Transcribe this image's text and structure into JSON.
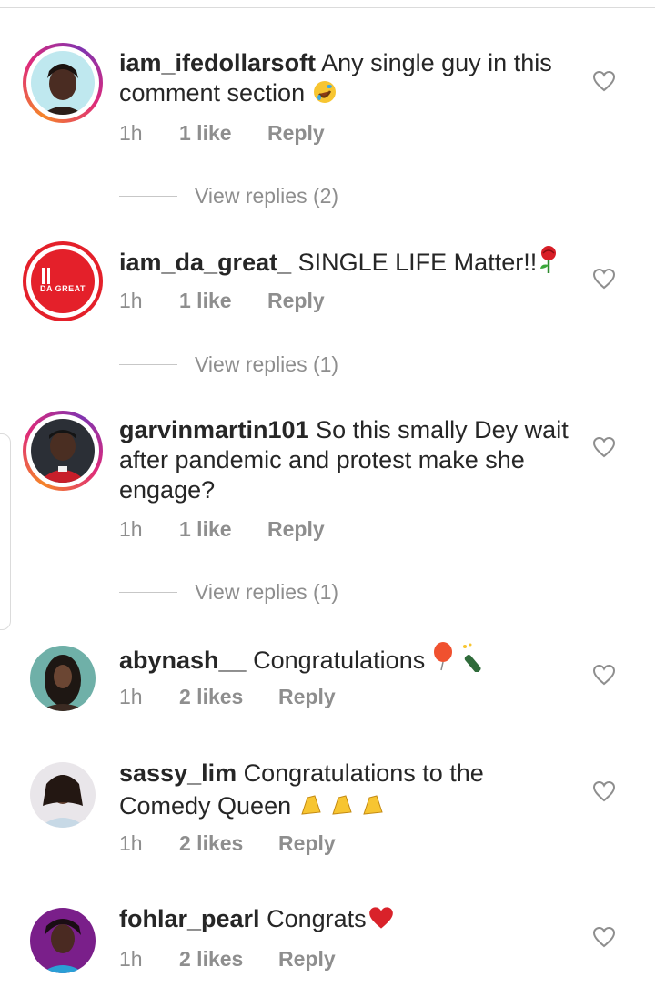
{
  "comments": [
    {
      "username": "iam_ifedollarsoft",
      "text": "Any single guy in this comment section",
      "emoji": "rofl-emoji",
      "time": "1h",
      "likes": "1 like",
      "reply": "Reply",
      "view_replies": "View replies (2)",
      "ring": "gradient"
    },
    {
      "username": "iam_da_great_",
      "text": "SINGLE LIFE Matter!!",
      "emoji": "rose-emoji",
      "avatar_text": "DA GREAT",
      "time": "1h",
      "likes": "1 like",
      "reply": "Reply",
      "view_replies": "View replies (1)",
      "ring": "red"
    },
    {
      "username": "garvinmartin101",
      "text": "So this smally Dey wait after pandemic and protest make she engage?",
      "time": "1h",
      "likes": "1 like",
      "reply": "Reply",
      "view_replies": "View replies (1)",
      "ring": "gradient"
    },
    {
      "username": "abynash__",
      "text": "Congratulations",
      "emoji": "balloon-champagne-emoji",
      "time": "1h",
      "likes": "2 likes",
      "reply": "Reply"
    },
    {
      "username": "sassy_lim",
      "text": "Congratulations to the Comedy Queen",
      "emoji": "clapping-hands-emoji",
      "time": "1h",
      "likes": "2 likes",
      "reply": "Reply"
    },
    {
      "username": "fohlar_pearl",
      "text": "Congrats",
      "emoji": "red-heart-emoji",
      "time": "1h",
      "likes": "2 likes",
      "reply": "Reply"
    }
  ],
  "colors": {
    "text": "#262626",
    "meta": "#8e8e8e",
    "story_ring_start": "#f58529",
    "story_ring_mid": "#dd2a7b",
    "red_ring": "#e4202a"
  }
}
